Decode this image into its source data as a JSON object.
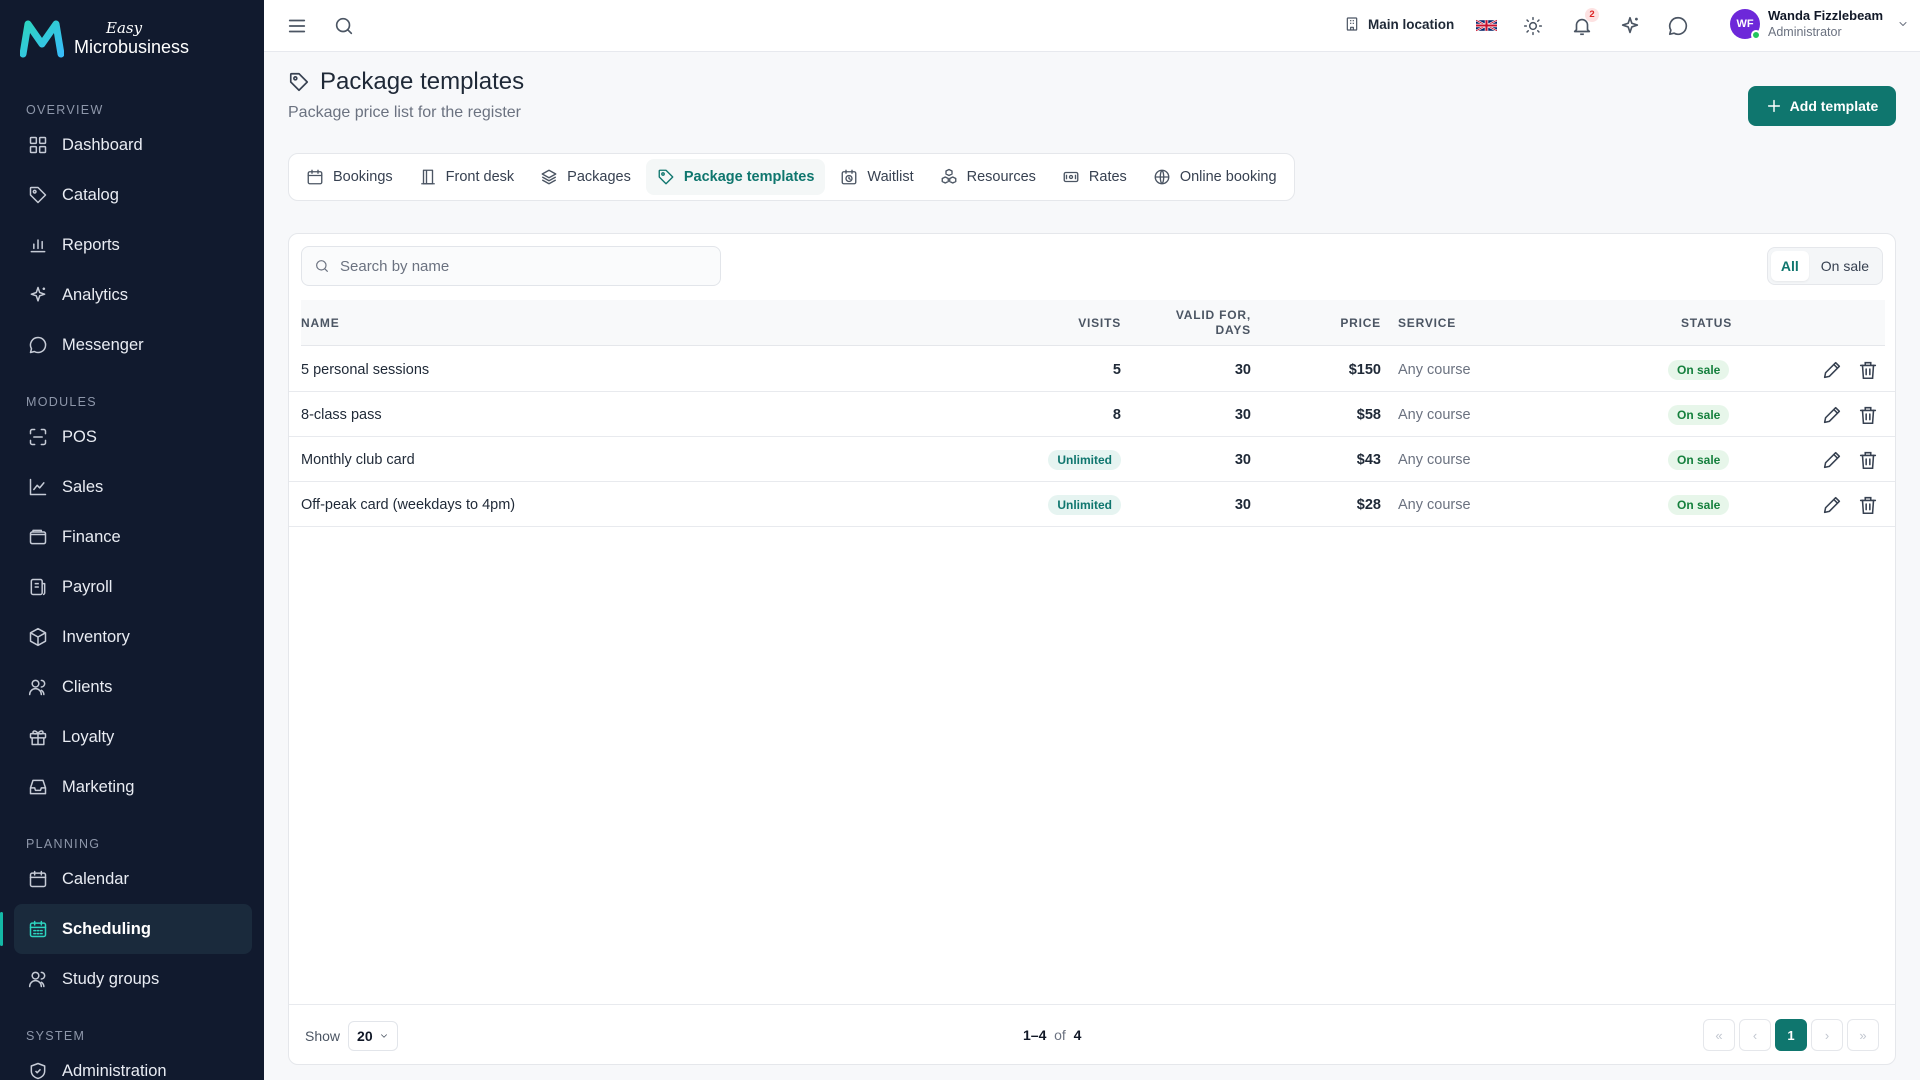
{
  "brand": {
    "small": "Easy",
    "name": "Microbusiness"
  },
  "sidebar": {
    "sections": [
      {
        "heading": "OVERVIEW",
        "items": [
          {
            "label": "Dashboard",
            "icon": "grid-icon"
          },
          {
            "label": "Catalog",
            "icon": "tag-icon"
          },
          {
            "label": "Reports",
            "icon": "bar-chart-icon"
          },
          {
            "label": "Analytics",
            "icon": "sparkle-icon"
          },
          {
            "label": "Messenger",
            "icon": "chat-icon"
          }
        ]
      },
      {
        "heading": "MODULES",
        "items": [
          {
            "label": "POS",
            "icon": "scan-icon"
          },
          {
            "label": "Sales",
            "icon": "line-chart-icon"
          },
          {
            "label": "Finance",
            "icon": "wallet-icon"
          },
          {
            "label": "Payroll",
            "icon": "payroll-icon"
          },
          {
            "label": "Inventory",
            "icon": "box-icon"
          },
          {
            "label": "Clients",
            "icon": "users-icon"
          },
          {
            "label": "Loyalty",
            "icon": "gift-icon"
          },
          {
            "label": "Marketing",
            "icon": "inbox-icon"
          }
        ]
      },
      {
        "heading": "PLANNING",
        "items": [
          {
            "label": "Calendar",
            "icon": "calendar-icon"
          },
          {
            "label": "Scheduling",
            "icon": "calendar-grid-icon",
            "active": true
          },
          {
            "label": "Study groups",
            "icon": "users-icon"
          }
        ]
      },
      {
        "heading": "SYSTEM",
        "items": [
          {
            "label": "Administration",
            "icon": "shield-icon"
          }
        ]
      }
    ]
  },
  "topbar": {
    "location": "Main location",
    "notifications_count": "2",
    "user": {
      "initials": "WF",
      "name": "Wanda Fizzlebeam",
      "role": "Administrator"
    }
  },
  "page": {
    "title": "Package templates",
    "subtitle": "Package price list for the register",
    "add_button": "Add template"
  },
  "tabs": [
    {
      "label": "Bookings",
      "icon": "calendar-icon"
    },
    {
      "label": "Front desk",
      "icon": "desk-icon"
    },
    {
      "label": "Packages",
      "icon": "layers-icon"
    },
    {
      "label": "Package templates",
      "icon": "tag-icon",
      "active": true
    },
    {
      "label": "Waitlist",
      "icon": "clock-calendar-icon"
    },
    {
      "label": "Resources",
      "icon": "cubes-icon"
    },
    {
      "label": "Rates",
      "icon": "ticket-icon"
    },
    {
      "label": "Online booking",
      "icon": "globe-icon"
    }
  ],
  "table": {
    "search_placeholder": "Search by name",
    "filters": [
      {
        "label": "All",
        "active": true
      },
      {
        "label": "On sale",
        "active": false
      }
    ],
    "columns": {
      "name": "NAME",
      "visits": "VISITS",
      "valid_line1": "VALID FOR,",
      "valid_line2": "DAYS",
      "price": "PRICE",
      "service": "SERVICE",
      "status": "STATUS"
    },
    "rows": [
      {
        "name": "5 personal sessions",
        "visits": "5",
        "visits_unlimited": false,
        "valid_days": "30",
        "price": "$150",
        "service": "Any course",
        "status": "On sale"
      },
      {
        "name": "8-class pass",
        "visits": "8",
        "visits_unlimited": false,
        "valid_days": "30",
        "price": "$58",
        "service": "Any course",
        "status": "On sale"
      },
      {
        "name": "Monthly club card",
        "visits": "Unlimited",
        "visits_unlimited": true,
        "valid_days": "30",
        "price": "$43",
        "service": "Any course",
        "status": "On sale"
      },
      {
        "name": "Off-peak card (weekdays to 4pm)",
        "visits": "Unlimited",
        "visits_unlimited": true,
        "valid_days": "30",
        "price": "$28",
        "service": "Any course",
        "status": "On sale"
      }
    ],
    "footer": {
      "show_label": "Show",
      "page_size": "20",
      "range": "1–4",
      "of_label": "of",
      "total": "4",
      "current_page": "1"
    }
  },
  "colors": {
    "accent": "#0f766e",
    "sidebar_bg": "#111a2e",
    "active_bar": "#14b8a6",
    "status_green": "#15803d"
  }
}
